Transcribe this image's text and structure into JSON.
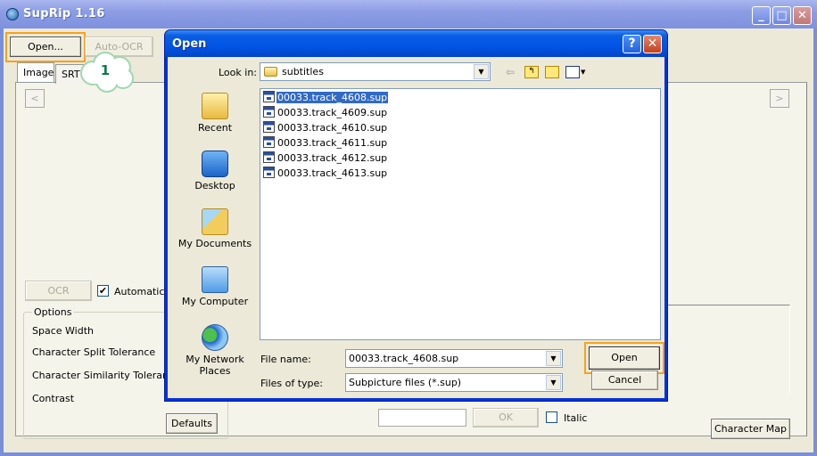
{
  "window": {
    "title": "SupRip 1.16",
    "controls": {
      "minimize": "_",
      "maximize": "□",
      "close": "✕"
    }
  },
  "toolbar": {
    "open_label": "Open...",
    "autoocr_label": "Auto-OCR"
  },
  "tabs": [
    {
      "label": "Image",
      "active": true
    },
    {
      "label": "SRT",
      "active": false
    }
  ],
  "nav": {
    "prev": "<",
    "next": ">"
  },
  "ocr": {
    "ocr_label": "OCR",
    "automatic_label": "Automatical",
    "automatic_checked": true
  },
  "options": {
    "legend": "Options",
    "rows": [
      "Space Width",
      "Character Split Tolerance",
      "Character Similarity Tolerance",
      "Contrast"
    ],
    "defaults_label": "Defaults"
  },
  "char_entry": {
    "value": "",
    "ok_label": "OK",
    "italic_label": "Italic",
    "italic_checked": false,
    "charmap_label": "Character Map"
  },
  "callout": {
    "number": "1"
  },
  "dialog": {
    "title": "Open",
    "help": "?",
    "close": "✕",
    "look_in_label": "Look in:",
    "look_in_value": "subtitles",
    "toolbar_icons": [
      "back-icon",
      "up-folder-icon",
      "new-folder-icon",
      "views-menu-icon"
    ],
    "places": [
      {
        "label": "Recent",
        "icon": "recent-icon"
      },
      {
        "label": "Desktop",
        "icon": "desktop-icon"
      },
      {
        "label": "My Documents",
        "icon": "my-documents-icon"
      },
      {
        "label": "My Computer",
        "icon": "my-computer-icon"
      },
      {
        "label": "My Network Places",
        "icon": "my-network-places-icon"
      }
    ],
    "files": [
      {
        "name": "00033.track_4608.sup",
        "selected": true
      },
      {
        "name": "00033.track_4609.sup",
        "selected": false
      },
      {
        "name": "00033.track_4610.sup",
        "selected": false
      },
      {
        "name": "00033.track_4611.sup",
        "selected": false
      },
      {
        "name": "00033.track_4612.sup",
        "selected": false
      },
      {
        "name": "00033.track_4613.sup",
        "selected": false
      }
    ],
    "file_name_label": "File name:",
    "file_name_value": "00033.track_4608.sup",
    "file_type_label": "Files of type:",
    "file_type_value": "Subpicture files (*.sup)",
    "open_label": "Open",
    "cancel_label": "Cancel"
  },
  "colors": {
    "highlight": "#f7a21b",
    "selection": "#316ac5",
    "dialog_frame": "#0831d9",
    "callout_text": "#0c7a4a"
  }
}
